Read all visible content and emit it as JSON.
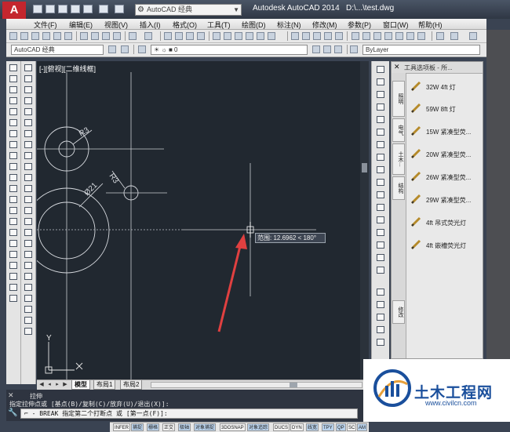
{
  "titlebar": {
    "app_logo": "A",
    "workspace": "AutoCAD 经典",
    "app_title": "Autodesk AutoCAD 2014",
    "doc_title": "D:\\...\\test.dwg"
  },
  "menubar": {
    "items": [
      "文件(F)",
      "编辑(E)",
      "视图(V)",
      "插入(I)",
      "格式(O)",
      "工具(T)",
      "绘图(D)",
      "标注(N)",
      "修改(M)",
      "参数(P)",
      "窗口(W)",
      "帮助(H)"
    ]
  },
  "toolbar2": {
    "workspace": "AutoCAD 经典",
    "layer": "0",
    "linetype": "ByLayer"
  },
  "drawing": {
    "viewport_label": "[-][俯视][二维线框]",
    "labels": {
      "r1": "R3",
      "r2": "R3",
      "d1": "Ø21"
    },
    "tooltip": "范围: 12.6962 < 180°",
    "ucs_y": "Y",
    "ucs_x": "X"
  },
  "palette": {
    "title": "工具选项板 - 所...",
    "tabs": [
      "照明",
      "电气",
      "土木...",
      "结构",
      "修改"
    ],
    "items": [
      "32W 4ft 灯",
      "59W 8ft 灯",
      "15W 紧凑型荧...",
      "20W 紧凑型荧...",
      "26W 紧凑型荧...",
      "29W 紧凑型荧...",
      "4ft 吊式荧光灯",
      "4ft 嵌槽荧光灯"
    ]
  },
  "layout_tabs": {
    "items": [
      "模型",
      "布局1",
      "布局2"
    ]
  },
  "command": {
    "line1": "拉伸",
    "line2": "指定拉伸点或 [基点(B)/复制(C)/放弃(U)/退出(X)]:",
    "input": "- BREAK 指定第二个打断点 或 [第一点(F)]:"
  },
  "statusbar": {
    "items": [
      "INFER",
      "捕捉",
      "栅格",
      "正交",
      "极轴",
      "对象捕捉",
      "3DOSNAP",
      "对象追踪",
      "DUCS",
      "DYN",
      "线宽",
      "TPY",
      "QP",
      "SC",
      "AM"
    ]
  },
  "watermark": {
    "main": "土木工程网",
    "url": "www.civilcn.com"
  },
  "colors": {
    "canvas": "#212830",
    "accent": "#e04040",
    "watermark": "#1a4f9c"
  }
}
